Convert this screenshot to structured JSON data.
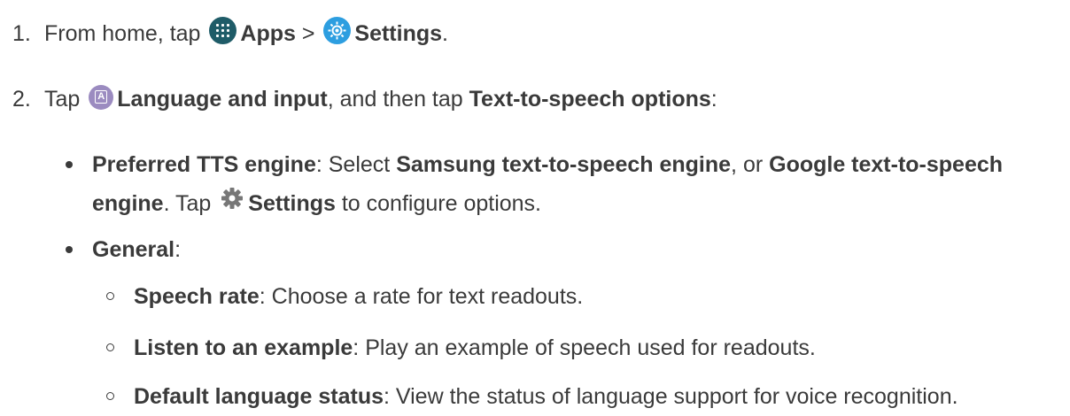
{
  "steps": [
    {
      "number": "1.",
      "t1": "From home, tap ",
      "apps_label": "Apps",
      "t2": " > ",
      "settings_label": "Settings",
      "t3": "."
    },
    {
      "number": "2.",
      "t1": "Tap ",
      "language_label": "Language and input",
      "t2": ", and then tap ",
      "tts_label": "Text-to-speech options",
      "t3": ":"
    }
  ],
  "bullets": {
    "preferred": {
      "label": "Preferred TTS engine",
      "t1": ": Select ",
      "samsung": "Samsung text-to-speech engine",
      "t2": ", or ",
      "google": "Google text-to-speech engine",
      "t3": ". Tap ",
      "settings": "Settings",
      "t4": " to configure options."
    },
    "general": {
      "label": "General",
      "t1": ":"
    }
  },
  "sub_items": [
    {
      "label": "Speech rate",
      "text": ": Choose a rate for text readouts."
    },
    {
      "label": "Listen to an example",
      "text": ": Play an example of speech used for readouts."
    },
    {
      "label": "Default language status",
      "text": ": View the status of language support for voice recognition."
    }
  ],
  "icons": {
    "apps": "apps-grid-icon",
    "settings": "settings-gear-icon",
    "language": "language-input-icon",
    "gear": "gear-icon"
  },
  "colors": {
    "text": "#3a3a3a",
    "apps_icon": "#1f5c68",
    "settings_icon": "#2d9ee0",
    "language_icon": "#9b8bc0",
    "gear_icon": "#777777"
  }
}
